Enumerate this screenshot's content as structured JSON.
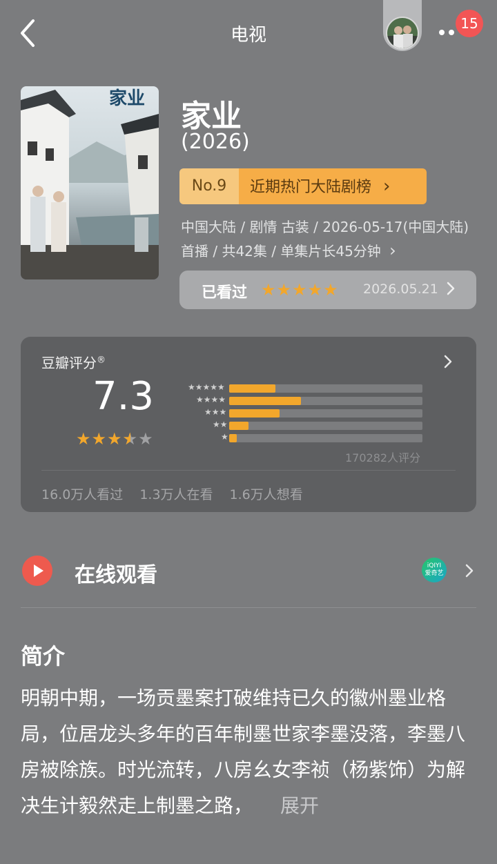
{
  "header": {
    "title": "电视",
    "notification_count": "15"
  },
  "show": {
    "title": "家业",
    "year": "(2026)",
    "poster_title": "家业",
    "rank": {
      "number": "No.9",
      "label": "近期热门大陆剧榜",
      "arrow": "›"
    },
    "meta": "中国大陆 / 剧情 古装 / 2026-05-17(中国大陆)首播 / 共42集 / 单集片长45分钟",
    "meta_arrow": "›",
    "watched": {
      "label": "已看过",
      "stars": "★★★★★",
      "date": "2026.05.21"
    }
  },
  "rating": {
    "title": "豆瓣评分",
    "registered": "®",
    "score": "7.3",
    "stars_value": 3.5,
    "distribution": [
      {
        "stars": "★★★★★",
        "fraction": 0.24
      },
      {
        "stars": "★★★★",
        "fraction": 0.37
      },
      {
        "stars": "★★★",
        "fraction": 0.26
      },
      {
        "stars": "★★",
        "fraction": 0.1
      },
      {
        "stars": "★",
        "fraction": 0.04
      }
    ],
    "count": "170282人评分",
    "stats": {
      "watched": "16.0万人看过",
      "watching": "1.3万人在看",
      "want": "1.6万人想看"
    }
  },
  "watch_online": {
    "label": "在线观看",
    "provider_line1": "iQIYI",
    "provider_line2": "爱奇艺"
  },
  "intro": {
    "title": "简介",
    "text": "明朝中期，一场贡墨案打破维持已久的徽州墨业格局，位居龙头多年的百年制墨世家李墨没落，李墨八房被除族。时光流转，八房幺女李祯（杨紫饰）为解决生计毅然走上制墨之路，",
    "expand": "展开"
  },
  "colors": {
    "background": "#7b7c7e",
    "accent_orange": "#f2a72c",
    "badge_red": "#f25555"
  }
}
